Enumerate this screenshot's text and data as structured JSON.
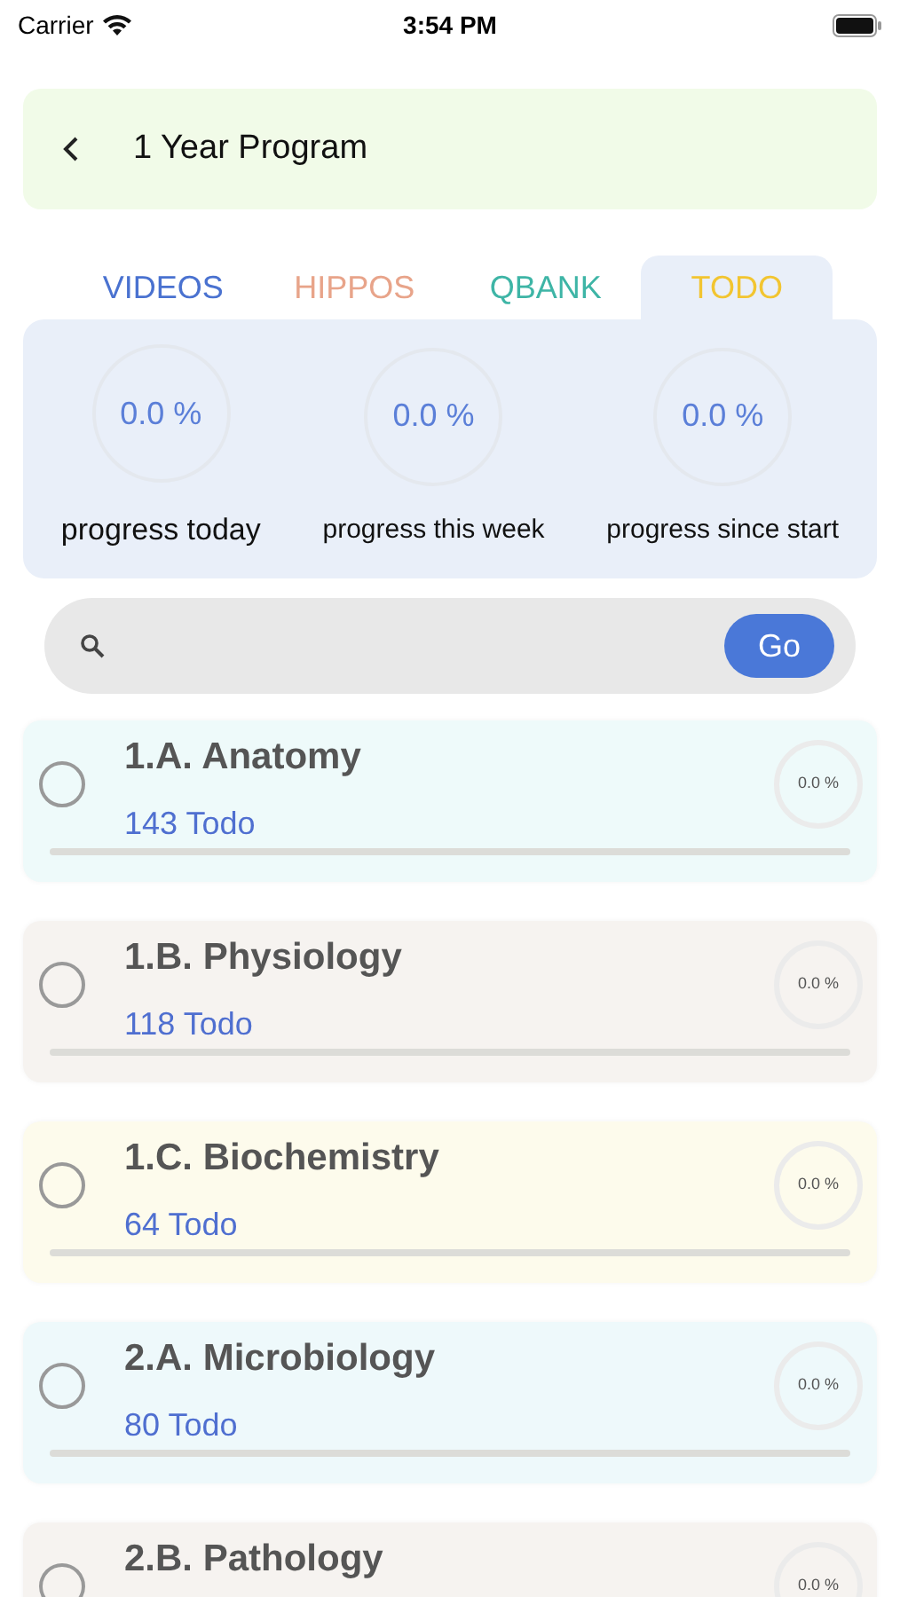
{
  "status_bar": {
    "carrier": "Carrier",
    "time": "3:54 PM"
  },
  "header": {
    "title": "1 Year Program"
  },
  "tabs": [
    {
      "label": "VIDEOS",
      "color": "#4a72d0",
      "selected": false
    },
    {
      "label": "HIPPOS",
      "color": "#e8a48a",
      "selected": false
    },
    {
      "label": "QBANK",
      "color": "#3eb5a6",
      "selected": false
    },
    {
      "label": "TODO",
      "color": "#f2c531",
      "selected": true
    }
  ],
  "stats": [
    {
      "value": "0.0 %",
      "label": "progress today"
    },
    {
      "value": "0.0 %",
      "label": "progress this week"
    },
    {
      "value": "0.0 %",
      "label": "progress since start"
    }
  ],
  "search": {
    "button": "Go"
  },
  "items": [
    {
      "title": "1.A. Anatomy",
      "count": "143 Todo",
      "percent": "0.0 %",
      "color": "#eefafa",
      "checked": false,
      "level": 0
    },
    {
      "title": "1.B. Physiology",
      "count": "118 Todo",
      "percent": "0.0 %",
      "color": "#f6f3f0",
      "checked": false,
      "level": 0
    },
    {
      "title": "1.C. Biochemistry",
      "count": "64 Todo",
      "percent": "0.0 %",
      "color": "#fdfbec",
      "checked": false,
      "level": 0
    },
    {
      "title": "2.A. Microbiology",
      "count": "80 Todo",
      "percent": "0.0 %",
      "color": "#eef9fb",
      "checked": false,
      "level": 0
    },
    {
      "title": "2.B. Pathology",
      "percent": "0.0 %",
      "color": "#f6f3f0",
      "checked": false
    }
  ]
}
